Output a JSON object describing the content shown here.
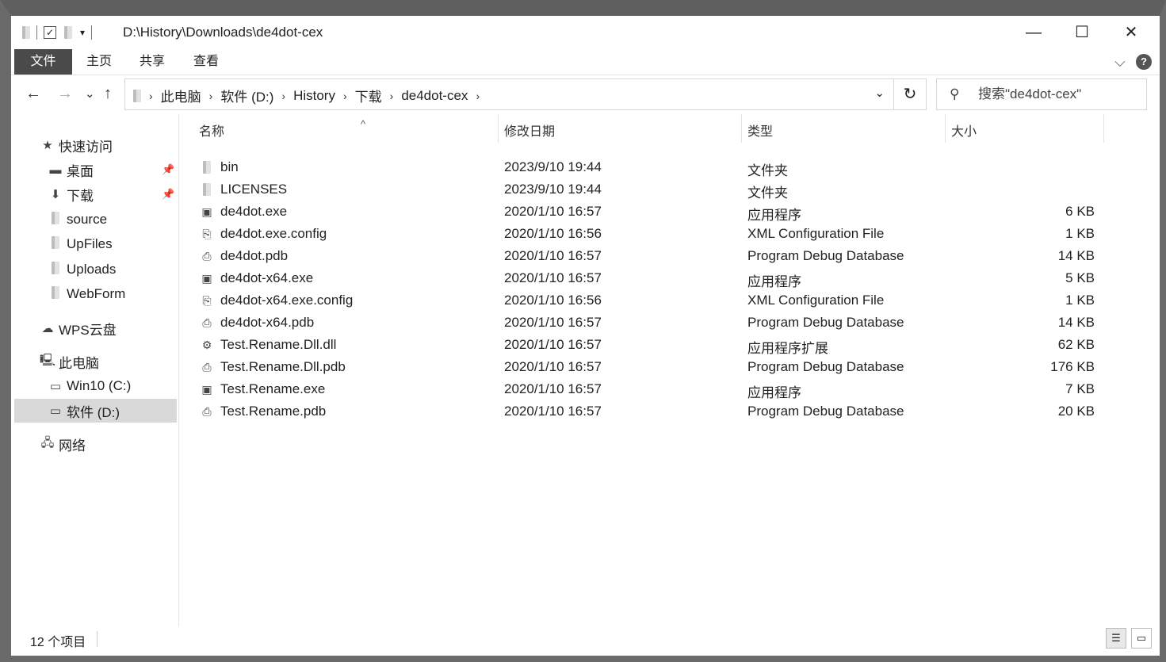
{
  "window": {
    "title": "D:\\History\\Downloads\\de4dot-cex",
    "minimize_glyph": "—",
    "maximize_glyph": "☐",
    "close_glyph": "✕"
  },
  "ribbon": {
    "tabs": [
      {
        "label": "文件"
      },
      {
        "label": "主页"
      },
      {
        "label": "共享"
      },
      {
        "label": "查看"
      }
    ],
    "expand_glyph": "⌵",
    "help_glyph": "?"
  },
  "nav": {
    "back": "←",
    "forward": "→",
    "recent": "⌄",
    "up": "↑",
    "breadcrumb": [
      "此电脑",
      "软件 (D:)",
      "History",
      "下载",
      "de4dot-cex"
    ],
    "refresh": "↻",
    "dropdown": "⌄"
  },
  "search": {
    "placeholder": "搜索\"de4dot-cex\""
  },
  "sidebar": {
    "quick_access": "快速访问",
    "items": [
      {
        "label": "桌面",
        "pinned": true
      },
      {
        "label": "下载",
        "pinned": true
      },
      {
        "label": "source"
      },
      {
        "label": "UpFiles"
      },
      {
        "label": "Uploads"
      },
      {
        "label": "WebForm"
      }
    ],
    "wps": "WPS云盘",
    "this_pc": "此电脑",
    "drives": [
      {
        "label": "Win10 (C:)"
      },
      {
        "label": "软件 (D:)",
        "selected": true
      }
    ],
    "network": "网络"
  },
  "columns": {
    "name": "名称",
    "date": "修改日期",
    "type": "类型",
    "size": "大小"
  },
  "files": [
    {
      "name": "bin",
      "date": "2023/9/10 19:44",
      "type": "文件夹",
      "size": "",
      "icon": "folder-icon"
    },
    {
      "name": "LICENSES",
      "date": "2023/9/10 19:44",
      "type": "文件夹",
      "size": "",
      "icon": "folder-icon"
    },
    {
      "name": "de4dot.exe",
      "date": "2020/1/10 16:57",
      "type": "应用程序",
      "size": "6 KB",
      "icon": "exe-icon"
    },
    {
      "name": "de4dot.exe.config",
      "date": "2020/1/10 16:56",
      "type": "XML Configuration File",
      "size": "1 KB",
      "icon": "config-icon"
    },
    {
      "name": "de4dot.pdb",
      "date": "2020/1/10 16:57",
      "type": "Program Debug Database",
      "size": "14 KB",
      "icon": "pdb-icon"
    },
    {
      "name": "de4dot-x64.exe",
      "date": "2020/1/10 16:57",
      "type": "应用程序",
      "size": "5 KB",
      "icon": "exe-icon"
    },
    {
      "name": "de4dot-x64.exe.config",
      "date": "2020/1/10 16:56",
      "type": "XML Configuration File",
      "size": "1 KB",
      "icon": "config-icon"
    },
    {
      "name": "de4dot-x64.pdb",
      "date": "2020/1/10 16:57",
      "type": "Program Debug Database",
      "size": "14 KB",
      "icon": "pdb-icon"
    },
    {
      "name": "Test.Rename.Dll.dll",
      "date": "2020/1/10 16:57",
      "type": "应用程序扩展",
      "size": "62 KB",
      "icon": "dll-icon"
    },
    {
      "name": "Test.Rename.Dll.pdb",
      "date": "2020/1/10 16:57",
      "type": "Program Debug Database",
      "size": "176 KB",
      "icon": "pdb-icon"
    },
    {
      "name": "Test.Rename.exe",
      "date": "2020/1/10 16:57",
      "type": "应用程序",
      "size": "7 KB",
      "icon": "exe-icon"
    },
    {
      "name": "Test.Rename.pdb",
      "date": "2020/1/10 16:57",
      "type": "Program Debug Database",
      "size": "20 KB",
      "icon": "pdb-icon"
    }
  ],
  "status": {
    "count_text": "12 个项目"
  }
}
